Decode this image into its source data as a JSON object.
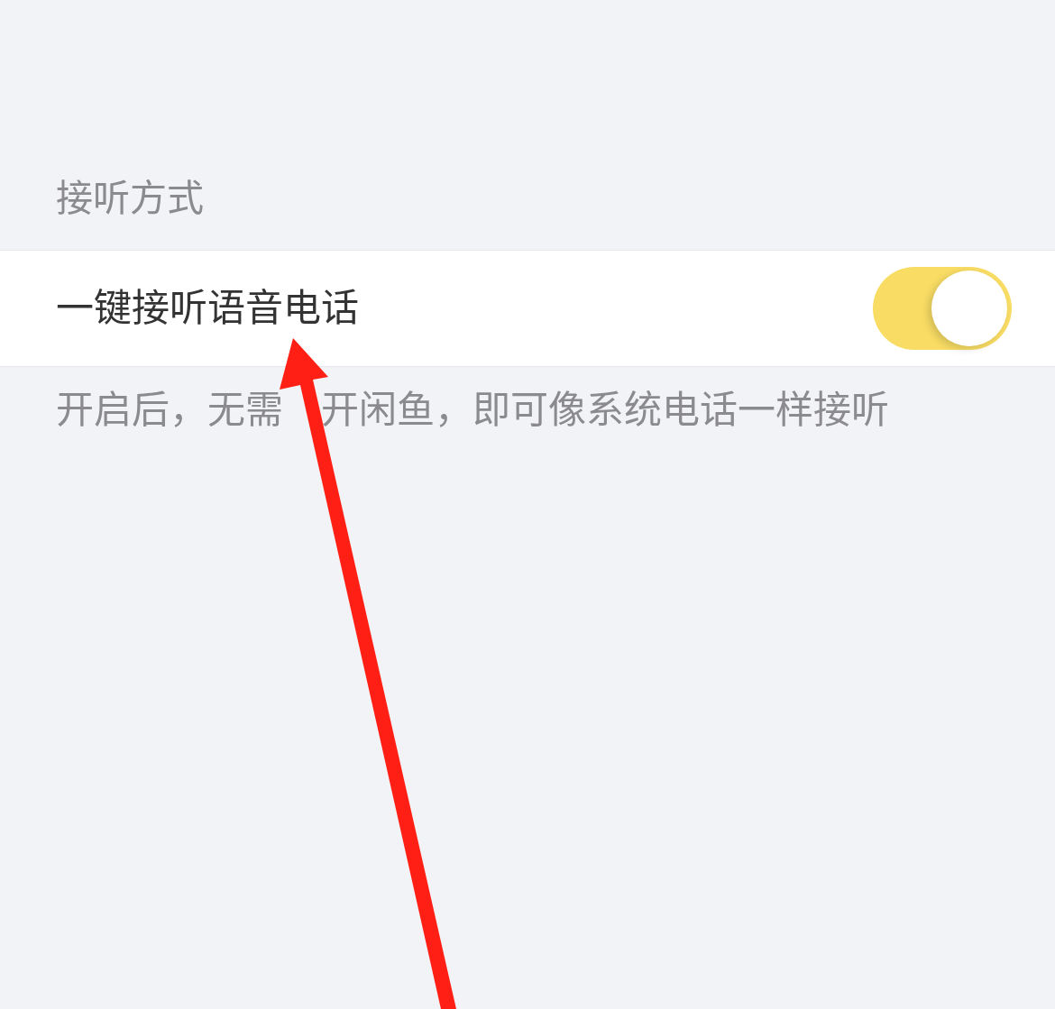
{
  "section": {
    "header": "接听方式",
    "items": [
      {
        "label": "一键接听语音电话",
        "on": true
      }
    ],
    "footer_parts": [
      "开启后，无需",
      "开闲鱼，即可像系统电话一样接听"
    ]
  }
}
